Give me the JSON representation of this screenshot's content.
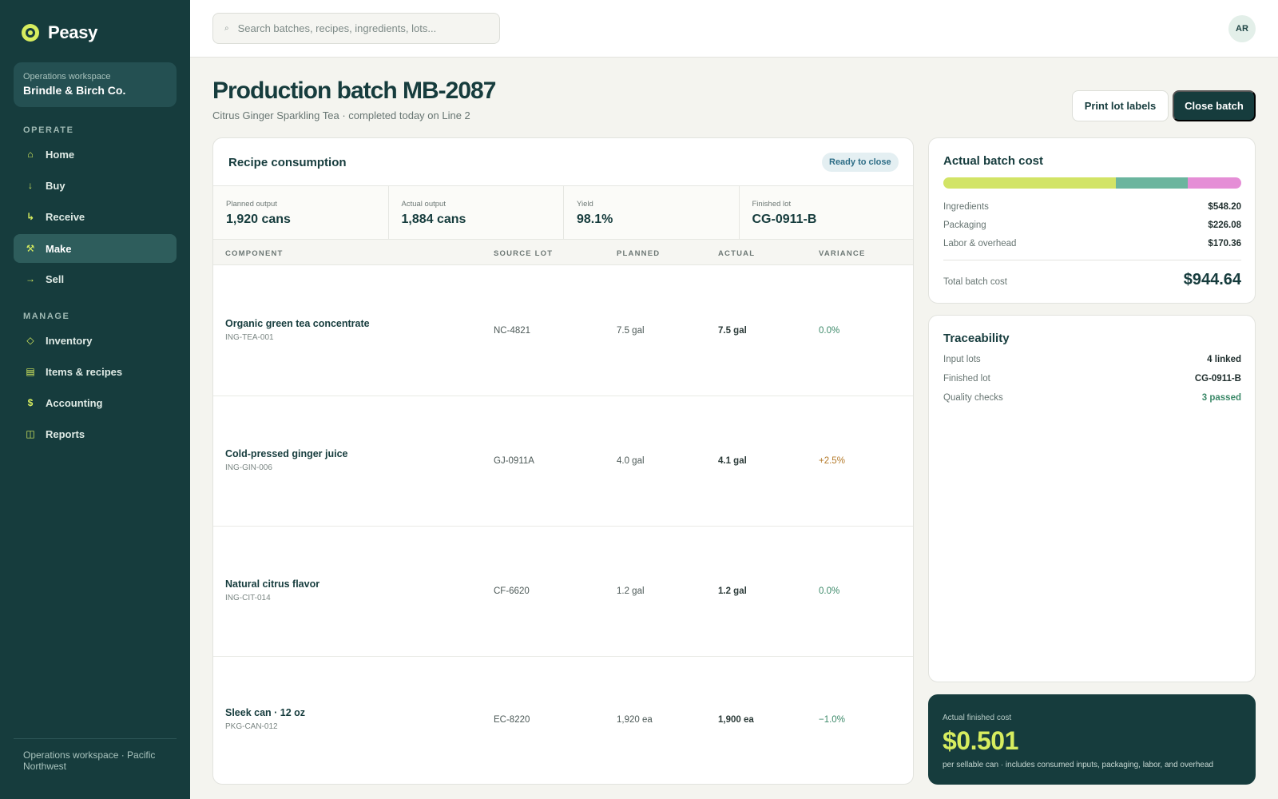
{
  "brand": {
    "name": "Peasy"
  },
  "workspace": {
    "label": "Operations workspace",
    "name": "Brindle & Birch Co."
  },
  "nav": {
    "operate_label": "OPERATE",
    "manage_label": "MANAGE",
    "operate": [
      {
        "label": "Home",
        "icon": "home-icon",
        "glyph": "⌂"
      },
      {
        "label": "Buy",
        "icon": "arrow-down-icon",
        "glyph": "↓"
      },
      {
        "label": "Receive",
        "icon": "corner-arrow-icon",
        "glyph": "↳"
      },
      {
        "label": "Make",
        "icon": "tools-icon",
        "glyph": "⚒",
        "active": true
      },
      {
        "label": "Sell",
        "icon": "arrow-right-icon",
        "glyph": "→"
      }
    ],
    "manage": [
      {
        "label": "Inventory",
        "icon": "diamond-icon",
        "glyph": "◇"
      },
      {
        "label": "Items & recipes",
        "icon": "list-icon",
        "glyph": "▤"
      },
      {
        "label": "Accounting",
        "icon": "dollar-icon",
        "glyph": "$"
      },
      {
        "label": "Reports",
        "icon": "columns-icon",
        "glyph": "◫"
      }
    ],
    "footer": "Operations workspace · Pacific Northwest"
  },
  "search": {
    "placeholder": "Search batches, recipes, ingredients, lots..."
  },
  "user": {
    "initials": "AR"
  },
  "header": {
    "title": "Production batch MB-2087",
    "subtitle": "Citrus Ginger Sparkling Tea · completed today on Line 2",
    "print_label": "Print lot labels",
    "close_label": "Close batch"
  },
  "recipe": {
    "title": "Recipe consumption",
    "badge": "Ready to close",
    "kpis": [
      {
        "label": "Planned output",
        "value": "1,920 cans"
      },
      {
        "label": "Actual output",
        "value": "1,884 cans"
      },
      {
        "label": "Yield",
        "value": "98.1%"
      },
      {
        "label": "Finished lot",
        "value": "CG-0911-B"
      }
    ],
    "columns": [
      "COMPONENT",
      "SOURCE LOT",
      "PLANNED",
      "ACTUAL",
      "VARIANCE"
    ],
    "rows": [
      {
        "name": "Organic green tea concentrate",
        "code": "ING-TEA-001",
        "lot": "NC-4821",
        "planned": "7.5 gal",
        "actual": "7.5 gal",
        "variance": "0.0%"
      },
      {
        "name": "Cold-pressed ginger juice",
        "code": "ING-GIN-006",
        "lot": "GJ-0911A",
        "planned": "4.0 gal",
        "actual": "4.1 gal",
        "variance": "+2.5%"
      },
      {
        "name": "Natural citrus flavor",
        "code": "ING-CIT-014",
        "lot": "CF-6620",
        "planned": "1.2 gal",
        "actual": "1.2 gal",
        "variance": "0.0%"
      },
      {
        "name": "Sleek can · 12 oz",
        "code": "PKG-CAN-012",
        "lot": "EC-8220",
        "planned": "1,920 ea",
        "actual": "1,900 ea",
        "variance": "−1.0%"
      }
    ]
  },
  "cost": {
    "title": "Actual batch cost",
    "colors": {
      "ingredients": "#d2e466",
      "packaging": "#6bb59e",
      "labor": "#e58ed6"
    },
    "lines": [
      {
        "label": "Ingredients",
        "amount": "$548.20",
        "value": 548.2
      },
      {
        "label": "Packaging",
        "amount": "$226.08",
        "value": 226.08
      },
      {
        "label": "Labor & overhead",
        "amount": "$170.36",
        "value": 170.36
      }
    ],
    "total_label": "Total batch cost",
    "total": "$944.64"
  },
  "trace": {
    "title": "Traceability",
    "lines": [
      {
        "label": "Input lots",
        "value": "4 linked"
      },
      {
        "label": "Finished lot",
        "value": "CG-0911-B"
      },
      {
        "label": "Quality checks",
        "value": "3 passed"
      }
    ]
  },
  "finished": {
    "label": "Actual finished cost",
    "value": "$0.501",
    "note": "per sellable can · includes consumed inputs, packaging, labor, and overhead"
  }
}
